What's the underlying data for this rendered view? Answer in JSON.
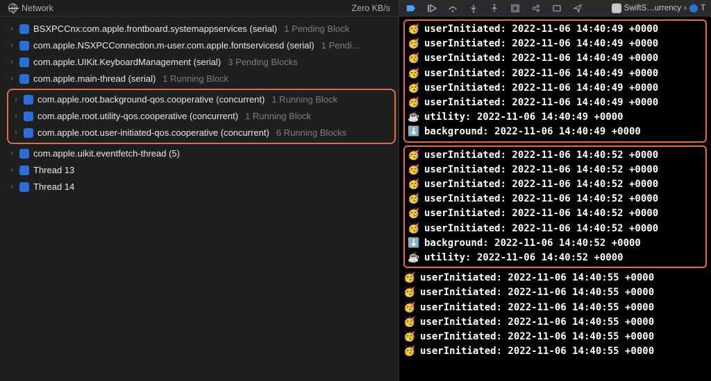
{
  "left_header": {
    "title": "Network",
    "rate": "Zero KB/s"
  },
  "threads": [
    {
      "name": "BSXPCCnx:com.apple.frontboard.systemappservices (serial)",
      "suffix": "1 Pending Block",
      "icon": "queue",
      "chevron": true
    },
    {
      "name": "com.apple.NSXPCConnection.m-user.com.apple.fontservicesd (serial)",
      "suffix": "1 Pendi…",
      "icon": "queue",
      "chevron": true
    },
    {
      "name": "com.apple.UIKit.KeyboardManagement (serial)",
      "suffix": "3 Pending Blocks",
      "icon": "queue",
      "chevron": true
    },
    {
      "name": "com.apple.main-thread (serial)",
      "suffix": "1 Running Block",
      "icon": "queue",
      "chevron": true
    }
  ],
  "highlighted_threads": [
    {
      "name": "com.apple.root.background-qos.cooperative (concurrent)",
      "suffix": "1 Running Block",
      "icon": "queue",
      "chevron": true
    },
    {
      "name": "com.apple.root.utility-qos.cooperative (concurrent)",
      "suffix": "1 Running Block",
      "icon": "queue",
      "chevron": true
    },
    {
      "name": "com.apple.root.user-initiated-qos.cooperative (concurrent)",
      "suffix": "6 Running Blocks",
      "icon": "queue",
      "chevron": true
    }
  ],
  "threads_after": [
    {
      "name": "com.apple.uikit.eventfetch-thread (5)",
      "suffix": "",
      "icon": "queue",
      "chevron": true
    },
    {
      "name": "Thread 13",
      "suffix": "",
      "icon": "thread",
      "chevron": true
    },
    {
      "name": "Thread 14",
      "suffix": "",
      "icon": "thread",
      "chevron": true
    }
  ],
  "breadcrumb": {
    "a": "SwiftS…urrency",
    "b": "T"
  },
  "log_groups": [
    [
      {
        "emoji": "🥳",
        "text": "userInitiated: 2022-11-06 14:40:49 +0000"
      },
      {
        "emoji": "🥳",
        "text": "userInitiated: 2022-11-06 14:40:49 +0000"
      },
      {
        "emoji": "🥳",
        "text": "userInitiated: 2022-11-06 14:40:49 +0000"
      },
      {
        "emoji": "🥳",
        "text": "userInitiated: 2022-11-06 14:40:49 +0000"
      },
      {
        "emoji": "🥳",
        "text": "userInitiated: 2022-11-06 14:40:49 +0000"
      },
      {
        "emoji": "🥳",
        "text": "userInitiated: 2022-11-06 14:40:49 +0000"
      },
      {
        "emoji": "☕️",
        "text": "utility: 2022-11-06 14:40:49 +0000"
      },
      {
        "emoji": "⬇️",
        "text": "background: 2022-11-06 14:40:49 +0000"
      }
    ],
    [
      {
        "emoji": "🥳",
        "text": "userInitiated: 2022-11-06 14:40:52 +0000"
      },
      {
        "emoji": "🥳",
        "text": "userInitiated: 2022-11-06 14:40:52 +0000"
      },
      {
        "emoji": "🥳",
        "text": "userInitiated: 2022-11-06 14:40:52 +0000"
      },
      {
        "emoji": "🥳",
        "text": "userInitiated: 2022-11-06 14:40:52 +0000"
      },
      {
        "emoji": "🥳",
        "text": "userInitiated: 2022-11-06 14:40:52 +0000"
      },
      {
        "emoji": "🥳",
        "text": "userInitiated: 2022-11-06 14:40:52 +0000"
      },
      {
        "emoji": "⬇️",
        "text": "background: 2022-11-06 14:40:52 +0000"
      },
      {
        "emoji": "☕️",
        "text": "utility: 2022-11-06 14:40:52 +0000"
      }
    ]
  ],
  "logs_after": [
    {
      "emoji": "🥳",
      "text": "userInitiated: 2022-11-06 14:40:55 +0000"
    },
    {
      "emoji": "🥳",
      "text": "userInitiated: 2022-11-06 14:40:55 +0000"
    },
    {
      "emoji": "🥳",
      "text": "userInitiated: 2022-11-06 14:40:55 +0000"
    },
    {
      "emoji": "🥳",
      "text": "userInitiated: 2022-11-06 14:40:55 +0000"
    },
    {
      "emoji": "🥳",
      "text": "userInitiated: 2022-11-06 14:40:55 +0000"
    },
    {
      "emoji": "🥳",
      "text": "userInitiated: 2022-11-06 14:40:55 +0000"
    }
  ]
}
